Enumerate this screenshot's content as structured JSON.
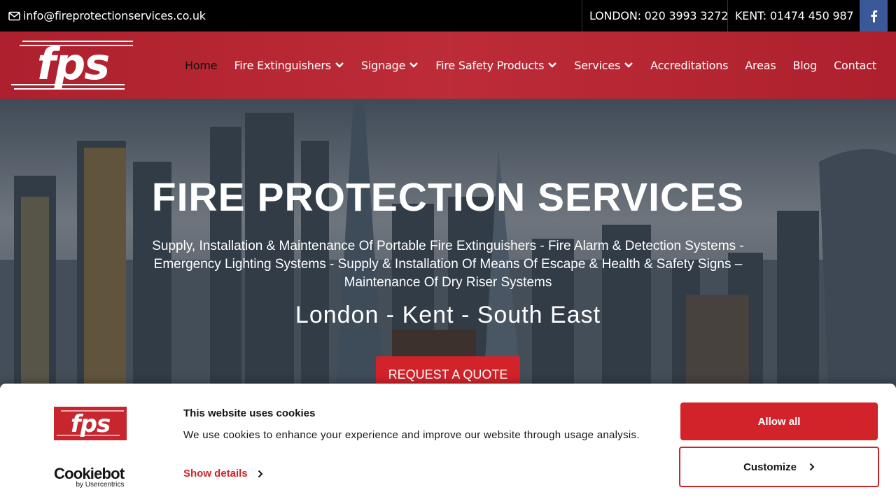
{
  "topbar": {
    "email": "info@fireprotectionservices.co.uk",
    "london_phone": "LONDON: 020 3993 3272",
    "kent_phone": "KENT: 01474 450 987",
    "facebook_icon": "facebook-icon",
    "facebook_color": "#3b5998"
  },
  "header": {
    "logo_text": "fps",
    "nav": [
      {
        "label": "Home",
        "active": true,
        "dropdown": false
      },
      {
        "label": "Fire Extinguishers",
        "active": false,
        "dropdown": true
      },
      {
        "label": "Signage",
        "active": false,
        "dropdown": true
      },
      {
        "label": "Fire Safety Products",
        "active": false,
        "dropdown": true
      },
      {
        "label": "Services",
        "active": false,
        "dropdown": true
      },
      {
        "label": "Accreditations",
        "active": false,
        "dropdown": false
      },
      {
        "label": "Areas",
        "active": false,
        "dropdown": false
      },
      {
        "label": "Blog",
        "active": false,
        "dropdown": false
      },
      {
        "label": "Contact",
        "active": false,
        "dropdown": false
      }
    ]
  },
  "hero": {
    "title": "FIRE PROTECTION SERVICES",
    "subtitle": "Supply, Installation & Maintenance Of Portable Fire Extinguishers - Fire Alarm & Detection Systems - Emergency Lighting Systems - Supply & Installation Of Means Of Escape & Health & Safety Signs – Maintenance Of Dry Riser Systems",
    "locations": "London - Kent - South East",
    "cta": "REQUEST A QUOTE"
  },
  "cookie_banner": {
    "logo_text": "fps",
    "title": "This website uses cookies",
    "text": "We use cookies to enhance your experience and improve our website through usage analysis.",
    "show_details": "Show details",
    "allow_all": "Allow all",
    "customize": "Customize",
    "provider": "Cookiebot",
    "provider_by": "by Usercentrics"
  },
  "colors": {
    "brand_red": "#d2232a",
    "topbar_bg": "#000000"
  }
}
